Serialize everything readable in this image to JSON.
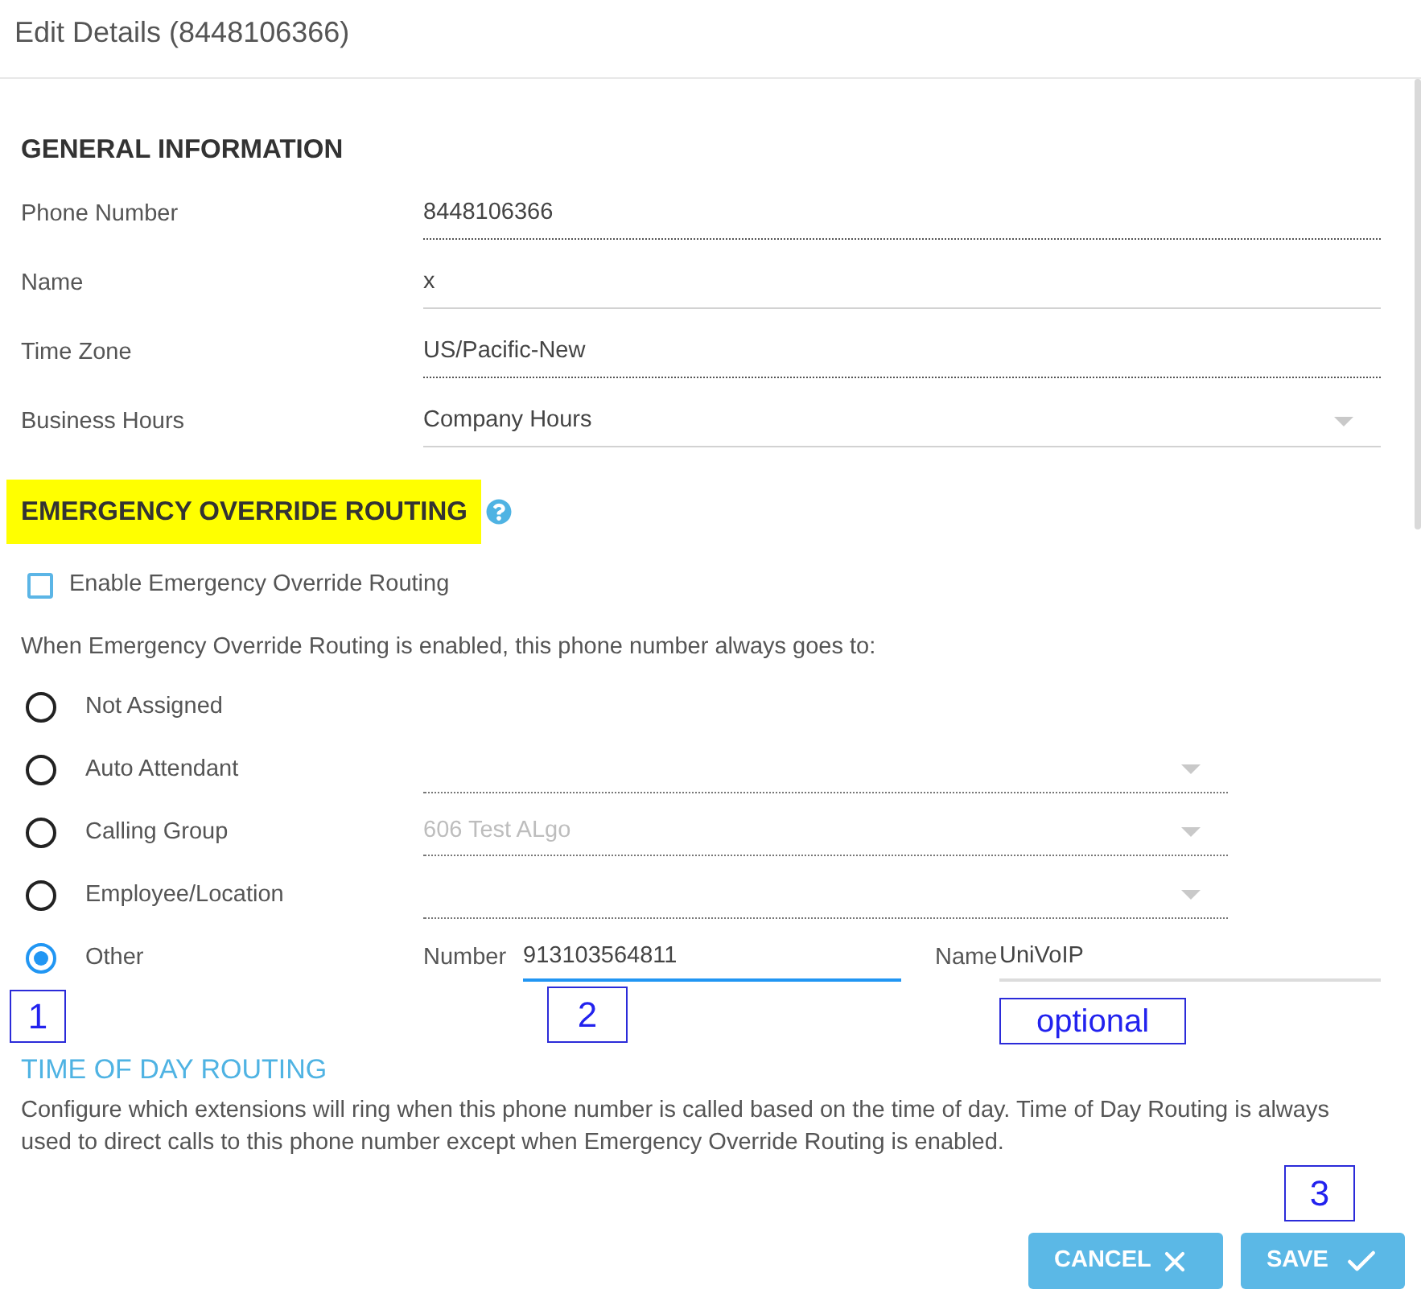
{
  "dialog": {
    "title": "Edit Details (8448106366)"
  },
  "general_information": {
    "heading": "GENERAL INFORMATION",
    "fields": [
      {
        "label": "Phone Number",
        "value": "8448106366",
        "kind": "text",
        "disabled": true
      },
      {
        "label": "Name",
        "value": "x",
        "kind": "text",
        "disabled": false
      },
      {
        "label": "Time Zone",
        "value": "US/Pacific-New",
        "kind": "text",
        "disabled": true
      },
      {
        "label": "Business Hours",
        "value": "Company Hours",
        "kind": "select",
        "disabled": false
      }
    ]
  },
  "emergency_override_routing": {
    "heading": "EMERGENCY OVERRIDE ROUTING",
    "highlighted": true,
    "checkbox": {
      "label": "Enable Emergency Override Routing",
      "checked": false
    },
    "description": "When Emergency Override Routing is enabled, this phone number always goes to:",
    "options": [
      {
        "label": "Not Assigned",
        "kind": "plain",
        "selected": false
      },
      {
        "label": "Auto Attendant",
        "kind": "dropdown",
        "selected": false,
        "disabled": true
      },
      {
        "label": "Calling Group",
        "kind": "dropdown",
        "selected": false,
        "disabled": true,
        "value": "606 Test ALgo"
      },
      {
        "label": "Employee/Location",
        "kind": "dropdown",
        "selected": false,
        "disabled": true
      },
      {
        "label": "Other",
        "kind": "number_name",
        "selected": true,
        "annotation": "1",
        "number": {
          "label": "Number",
          "value": "913103564811",
          "focused": true,
          "annotation": "2"
        },
        "name": {
          "label": "Name",
          "value": "UniVoIP",
          "focused": false,
          "annotation": "optional"
        }
      }
    ]
  },
  "time_of_day_routing": {
    "heading": "TIME OF DAY ROUTING",
    "description": "Configure which extensions will ring when this phone number is called based on the time of day. Time of Day Routing is always used to direct calls to this phone number except when Emergency Override Routing is enabled."
  },
  "buttons": [
    {
      "label": "CANCEL",
      "kind": "cancel"
    },
    {
      "label": "SAVE",
      "kind": "save",
      "annotation": "3"
    }
  ]
}
